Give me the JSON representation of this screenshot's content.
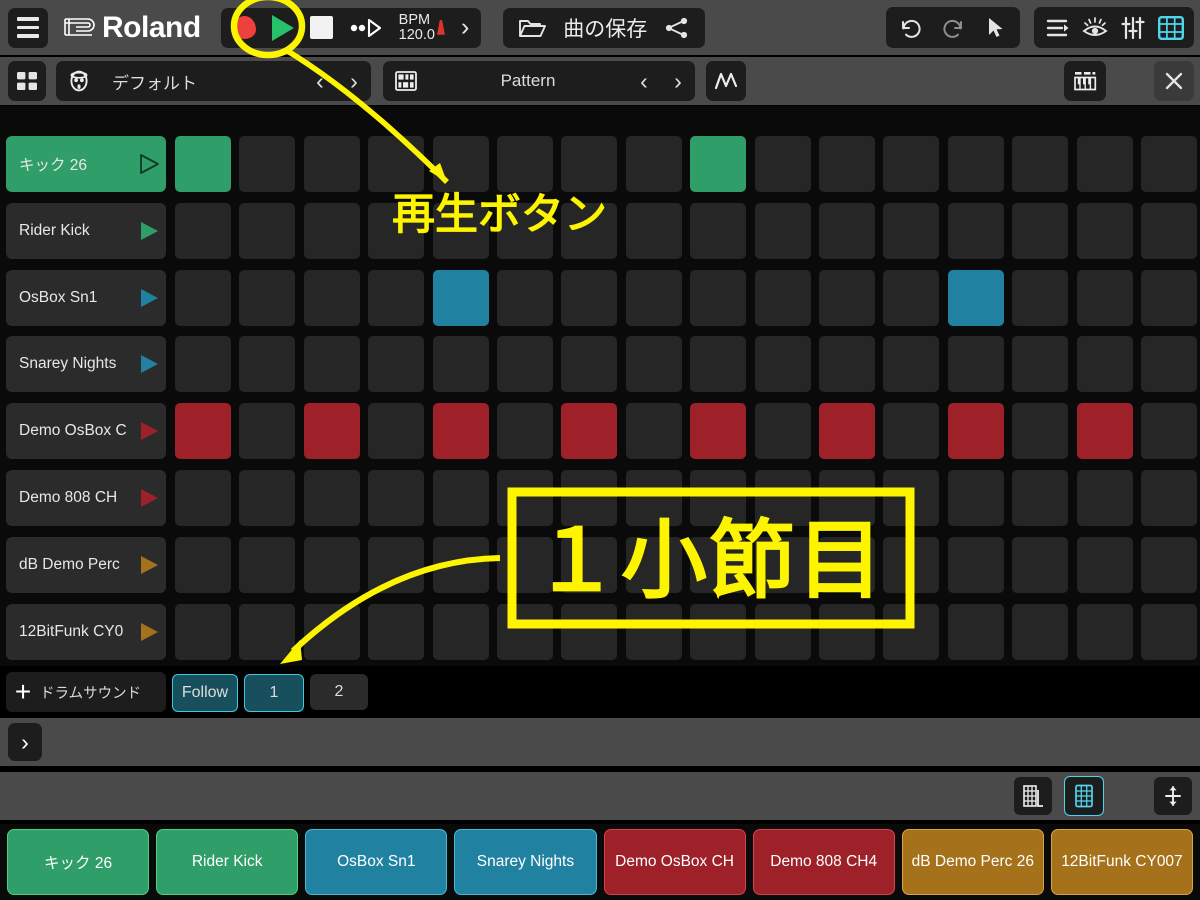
{
  "toolbar": {
    "menu_icon": "hamburger-icon",
    "brand": "Roland",
    "transport": {
      "record_icon": "record-icon",
      "play_icon": "play-icon",
      "stop_icon": "stop-icon",
      "loop_icon": "skip-forward-icon",
      "bpm_label": "BPM",
      "bpm_value": "120.0",
      "metronome_icon": "metronome-icon",
      "expand_icon": "chevron-right-icon"
    },
    "file": {
      "folder_icon": "folder-open-icon",
      "save_label": "曲の保存",
      "share_icon": "share-icon"
    },
    "right_group_1": [
      "undo-icon",
      "redo-icon",
      "pointer-icon"
    ],
    "right_group_2": [
      "list-align-icon",
      "eye-icon",
      "mixer-sliders-icon",
      "grid-view-icon"
    ],
    "grid_view_active_color": "#4fd6ef"
  },
  "bar2": {
    "apps_icon": "apps-grid-icon",
    "kit": {
      "icon": "drum-kit-icon",
      "label": "デフォルト",
      "prev": "‹",
      "next": "›"
    },
    "pattern": {
      "icon": "pattern-grid-icon",
      "label": "Pattern",
      "prev": "‹",
      "next": "›"
    },
    "automation_icon": "automation-curve-icon",
    "keyboard_icon": "keyboard-icon",
    "close_icon": "close-icon"
  },
  "sequencer": {
    "step_count": 16,
    "colors": {
      "green": "#2f9e68",
      "blue": "#2082a0",
      "red": "#9e2029",
      "amber": "#a6711b",
      "inactive": "#262626",
      "row_bg": "#2b2b2b"
    },
    "tracks": [
      {
        "name": "キック 26",
        "color": "#2f9e68",
        "selected": true,
        "steps": [
          1,
          0,
          0,
          0,
          0,
          0,
          0,
          0,
          1,
          0,
          0,
          0,
          0,
          0,
          0,
          0
        ]
      },
      {
        "name": "Rider Kick",
        "color": "#2f9e68",
        "selected": false,
        "steps": [
          0,
          0,
          0,
          0,
          0,
          0,
          0,
          0,
          0,
          0,
          0,
          0,
          0,
          0,
          0,
          0
        ]
      },
      {
        "name": "OsBox Sn1",
        "color": "#2082a0",
        "selected": false,
        "steps": [
          0,
          0,
          0,
          0,
          1,
          0,
          0,
          0,
          0,
          0,
          0,
          0,
          1,
          0,
          0,
          0
        ]
      },
      {
        "name": "Snarey Nights",
        "color": "#2082a0",
        "selected": false,
        "steps": [
          0,
          0,
          0,
          0,
          0,
          0,
          0,
          0,
          0,
          0,
          0,
          0,
          0,
          0,
          0,
          0
        ]
      },
      {
        "name": "Demo OsBox C",
        "color": "#9e2029",
        "selected": false,
        "steps": [
          1,
          0,
          1,
          0,
          1,
          0,
          1,
          0,
          1,
          0,
          1,
          0,
          1,
          0,
          1,
          0
        ]
      },
      {
        "name": "Demo 808 CH",
        "color": "#9e2029",
        "selected": false,
        "steps": [
          0,
          0,
          0,
          0,
          0,
          0,
          0,
          0,
          0,
          0,
          0,
          0,
          0,
          0,
          0,
          0
        ]
      },
      {
        "name": "dB Demo Perc",
        "color": "#a6711b",
        "selected": false,
        "steps": [
          0,
          0,
          0,
          0,
          0,
          0,
          0,
          0,
          0,
          0,
          0,
          0,
          0,
          0,
          0,
          0
        ]
      },
      {
        "name": "12BitFunk CY0",
        "color": "#a6711b",
        "selected": false,
        "steps": [
          0,
          0,
          0,
          0,
          0,
          0,
          0,
          0,
          0,
          0,
          0,
          0,
          0,
          0,
          0,
          0
        ]
      }
    ]
  },
  "footer": {
    "add_icon": "plus-icon",
    "add_label": "ドラムサウンド",
    "follow_label": "Follow",
    "follow_active": true,
    "pages": [
      {
        "label": "1",
        "active": true
      },
      {
        "label": "2",
        "active": false
      }
    ],
    "expand_icon": "chevron-right-icon",
    "strip_icons": [
      "mixer-channel-icon",
      "pad-grid-icon",
      "resize-vertical-icon"
    ],
    "pad_grid_active_color": "#4fd6ef"
  },
  "pads": [
    {
      "label": "キック 26",
      "color": "#2f9e68",
      "border": "#4fd07f"
    },
    {
      "label": "Rider Kick",
      "color": "#2f9e68",
      "border": "#4fd07f"
    },
    {
      "label": "OsBox Sn1",
      "color": "#2082a0",
      "border": "#49b8d6"
    },
    {
      "label": "Snarey Nights",
      "color": "#2082a0",
      "border": "#49b8d6"
    },
    {
      "label": "Demo OsBox CH",
      "color": "#9e2029",
      "border": "#d8404c"
    },
    {
      "label": "Demo 808 CH4",
      "color": "#9e2029",
      "border": "#d8404c"
    },
    {
      "label": "dB Demo Perc 26",
      "color": "#a6711b",
      "border": "#d9a349"
    },
    {
      "label": "12BitFunk CY007",
      "color": "#a6711b",
      "border": "#d9a349"
    }
  ],
  "annotations": {
    "color": "#fdf500",
    "play_button_label": "再生ボタン",
    "first_bar_label": "１小節目"
  }
}
